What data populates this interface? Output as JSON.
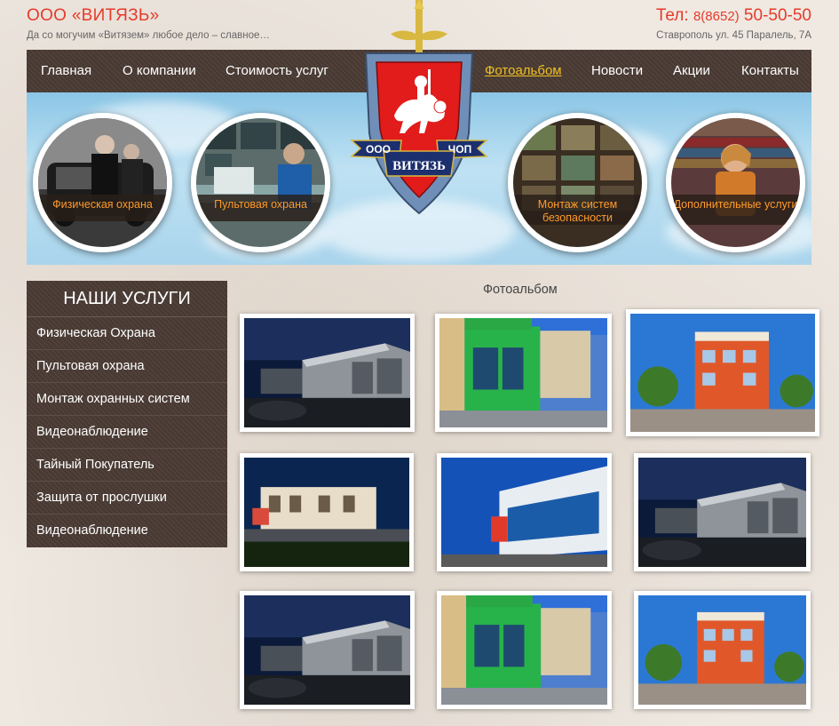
{
  "header": {
    "company": "ООО «ВИТЯЗЬ»",
    "slogan": "Да со могучим «Витязем» любое дело – славное…",
    "phone_prefix": "Тел: ",
    "phone_code": "8(8652)",
    "phone_number": " 50-50-50",
    "address": "Ставрополь ул. 45 Паралель, 7А"
  },
  "nav": {
    "items": [
      "Главная",
      "О компании",
      "Стоимость услуг",
      "Фотоальбом",
      "Новости",
      "Акции",
      "Контакты"
    ],
    "active": "Фотоальбом"
  },
  "logo": {
    "left_text": "ООО",
    "right_text": "ЧОП",
    "name": "ВИТЯЗЬ"
  },
  "banner": {
    "services": [
      "Физическая охрана",
      "Пультовая охрана",
      "Монтаж систем безопасности",
      "Дополнительные услуги"
    ]
  },
  "sidebar": {
    "title": "НАШИ УСЛУГИ",
    "items": [
      "Физическая Охрана",
      "Пультовая охрана",
      "Монтаж охранных систем",
      "Видеонаблюдение",
      "Тайный Покупатель",
      "Защита от прослушки",
      "Видеонаблюдение"
    ]
  },
  "gallery": {
    "title": "Фотоальбом",
    "photos": [
      "warehouse",
      "shopfront",
      "building",
      "office-building",
      "blue-building",
      "warehouse",
      "warehouse",
      "shopfront",
      "building"
    ]
  },
  "colors": {
    "accent": "#e63a2a",
    "nav_bg": "#4a3b34",
    "active_nav": "#f0c020",
    "label_text": "#ff9a2a"
  }
}
